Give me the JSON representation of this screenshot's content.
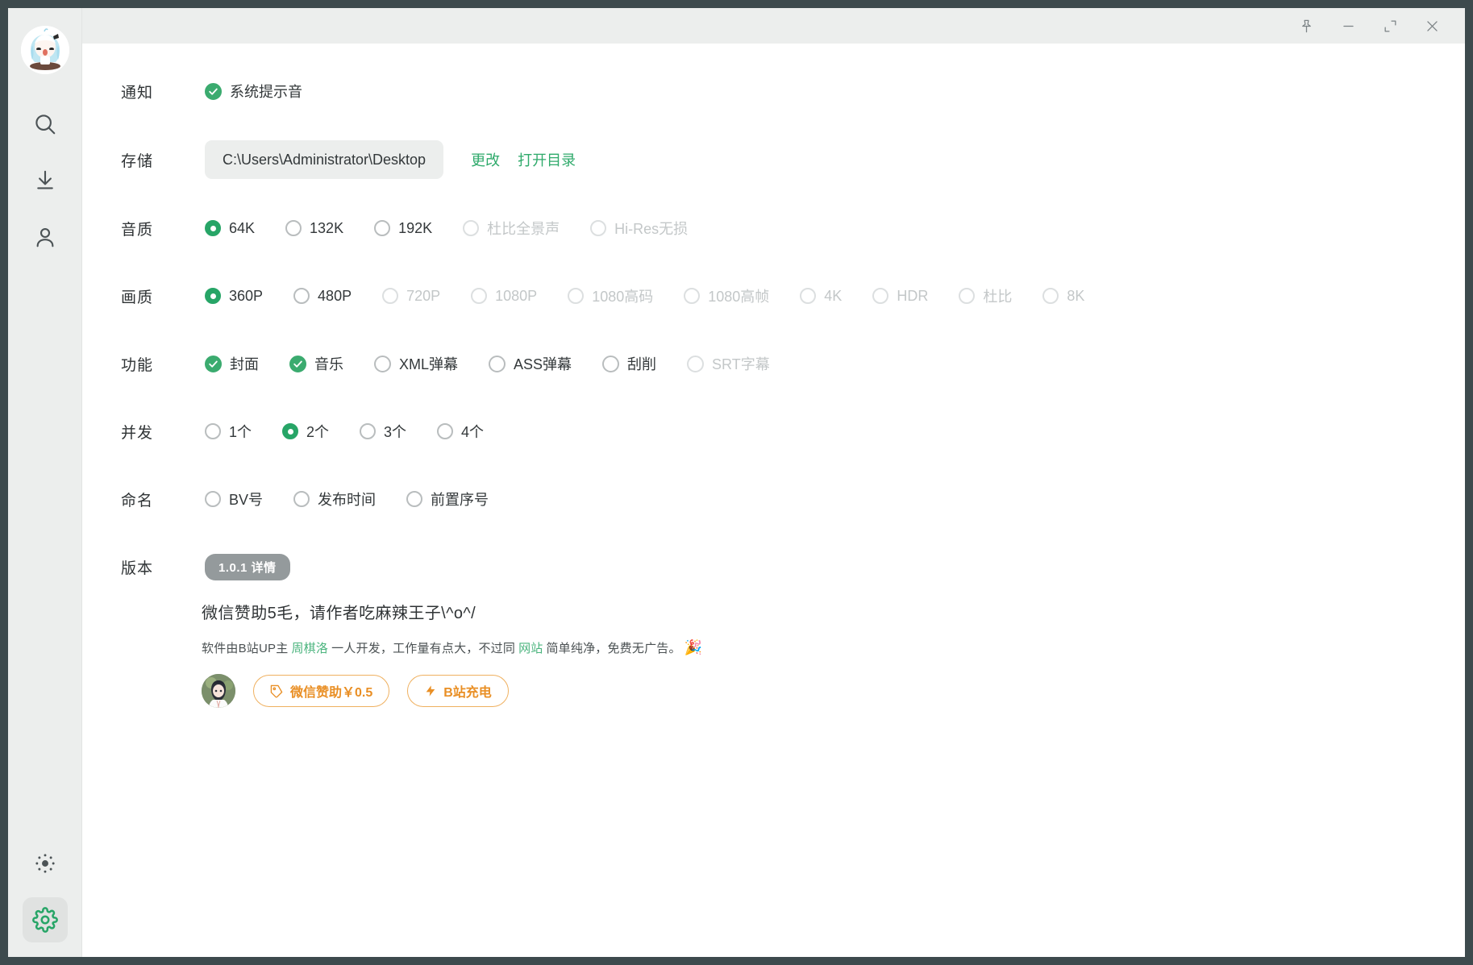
{
  "window": {
    "controls": [
      {
        "name": "pin",
        "label": "置顶"
      },
      {
        "name": "minimize",
        "label": "最小化"
      },
      {
        "name": "maximize",
        "label": "最大化"
      },
      {
        "name": "close",
        "label": "关闭"
      }
    ]
  },
  "sidebar": {
    "avatar_label": "用户头像",
    "items": [
      {
        "icon": "search-icon",
        "label": "搜索"
      },
      {
        "icon": "download-icon",
        "label": "下载"
      },
      {
        "icon": "user-icon",
        "label": "我的"
      }
    ],
    "bottom": [
      {
        "icon": "brightness-icon",
        "label": "主题",
        "active": false
      },
      {
        "icon": "gear-icon",
        "label": "设置",
        "active": true
      }
    ]
  },
  "settings": {
    "notification": {
      "label": "通知",
      "options": [
        {
          "label": "系统提示音",
          "checked": true,
          "disabled": false
        }
      ]
    },
    "storage": {
      "label": "存储",
      "path": "C:\\Users\\Administrator\\Desktop",
      "change_label": "更改",
      "open_label": "打开目录"
    },
    "audio_quality": {
      "label": "音质",
      "options": [
        {
          "label": "64K",
          "selected": true,
          "disabled": false
        },
        {
          "label": "132K",
          "selected": false,
          "disabled": false
        },
        {
          "label": "192K",
          "selected": false,
          "disabled": false
        },
        {
          "label": "杜比全景声",
          "selected": false,
          "disabled": true
        },
        {
          "label": "Hi-Res无损",
          "selected": false,
          "disabled": true
        }
      ]
    },
    "video_quality": {
      "label": "画质",
      "options": [
        {
          "label": "360P",
          "selected": true,
          "disabled": false
        },
        {
          "label": "480P",
          "selected": false,
          "disabled": false
        },
        {
          "label": "720P",
          "selected": false,
          "disabled": true
        },
        {
          "label": "1080P",
          "selected": false,
          "disabled": true
        },
        {
          "label": "1080高码",
          "selected": false,
          "disabled": true
        },
        {
          "label": "1080高帧",
          "selected": false,
          "disabled": true
        },
        {
          "label": "4K",
          "selected": false,
          "disabled": true
        },
        {
          "label": "HDR",
          "selected": false,
          "disabled": true
        },
        {
          "label": "杜比",
          "selected": false,
          "disabled": true
        },
        {
          "label": "8K",
          "selected": false,
          "disabled": true
        }
      ]
    },
    "features": {
      "label": "功能",
      "options": [
        {
          "label": "封面",
          "checked": true,
          "disabled": false
        },
        {
          "label": "音乐",
          "checked": true,
          "disabled": false
        },
        {
          "label": "XML弹幕",
          "checked": false,
          "disabled": false
        },
        {
          "label": "ASS弹幕",
          "checked": false,
          "disabled": false
        },
        {
          "label": "刮削",
          "checked": false,
          "disabled": false
        },
        {
          "label": "SRT字幕",
          "checked": false,
          "disabled": true
        }
      ]
    },
    "concurrency": {
      "label": "并发",
      "options": [
        {
          "label": "1个",
          "selected": false,
          "disabled": false
        },
        {
          "label": "2个",
          "selected": true,
          "disabled": false
        },
        {
          "label": "3个",
          "selected": false,
          "disabled": false
        },
        {
          "label": "4个",
          "selected": false,
          "disabled": false
        }
      ]
    },
    "naming": {
      "label": "命名",
      "options": [
        {
          "label": "BV号",
          "selected": false,
          "disabled": false
        },
        {
          "label": "发布时间",
          "selected": false,
          "disabled": false
        },
        {
          "label": "前置序号",
          "selected": false,
          "disabled": false
        }
      ]
    },
    "version": {
      "label": "版本",
      "badge": "1.0.1 详情"
    }
  },
  "donate": {
    "headline": "微信赞助5毛，请作者吃麻辣王子\\^o^/",
    "desc_1": "软件由B站UP主",
    "desc_link_1": "周棋洛",
    "desc_2": "一人开发，工作量有点大，不过同",
    "desc_link_2": "网站",
    "desc_3": "简单纯净，免费无广告。",
    "desc_emoji": "🎉",
    "avatar_label": "作者头像",
    "wechat_button": "微信赞助￥0.5",
    "bili_button": "B站充电"
  },
  "colors": {
    "accent_green": "#27a567",
    "link_green": "#2faa6b",
    "orange": "#e98f25",
    "sidebar_bg": "#eceeed",
    "window_border": "#3d4a4d"
  }
}
